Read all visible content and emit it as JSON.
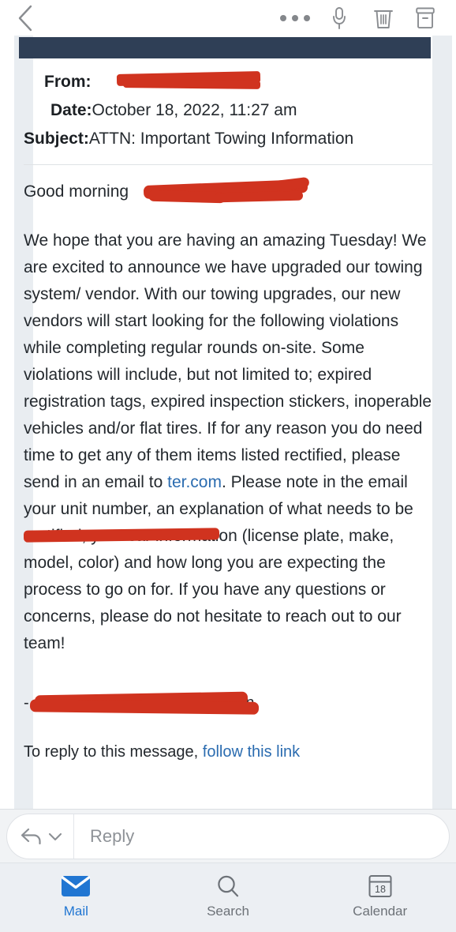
{
  "toolbar": {
    "back_icon": "chevron-left-icon",
    "more_icon": "more-horizontal-icon",
    "mic_icon": "microphone-icon",
    "trash_icon": "trash-icon",
    "archive_icon": "archive-icon"
  },
  "email": {
    "from_label": "From:",
    "from_value": "",
    "date_label": "Date:",
    "date_value": "October 18, 2022, 11:27 am",
    "subject_label": "Subject:",
    "subject_value": "ATTN: Important Towing Information",
    "greeting": "Good morning ",
    "body_paragraph": "We hope that you are having an amazing Tuesday! We are excited to announce we have upgraded our towing system/ vendor. With our towing upgrades, our new vendors will start looking for the following violations while completing regular rounds on-site. Some violations will include, but not limited to; expired registration tags, expired inspection stickers, inoperable vehicles and/or flat tires. If for any reason you do need time to get any of them items listed rectified, please send in an email to ",
    "body_email_link": "ter.com",
    "body_paragraph_continued": ". Please note in the email your unit number, an explanation of what needs to be rectified, your car information (license plate, make, model, color) and how long you are expecting the process to go on for. If you have any questions or concerns, please do not hesitate to reach out to our team!",
    "signature": "-",
    "signature_tail": "rn",
    "reply_prompt_text": "To reply to this message, ",
    "reply_prompt_link": "follow this link"
  },
  "reply_bar": {
    "reply_icon": "reply-arrow-icon",
    "chevron_icon": "chevron-down-icon",
    "placeholder": "Reply",
    "value": ""
  },
  "tabbar": {
    "tabs": [
      {
        "label": "Mail",
        "icon": "mail-envelope-icon",
        "active": true
      },
      {
        "label": "Search",
        "icon": "search-magnifier-icon",
        "active": false
      },
      {
        "label": "Calendar",
        "icon": "calendar-icon",
        "active": false
      }
    ],
    "calendar_day": "18"
  },
  "colors": {
    "accent_blue": "#2176d2",
    "link_blue": "#2b6cb0",
    "redaction_red": "#d0331f",
    "header_band_navy": "#2f3f56",
    "tabbar_bg": "#eceff3",
    "gutter_gray": "#e9edf1"
  }
}
